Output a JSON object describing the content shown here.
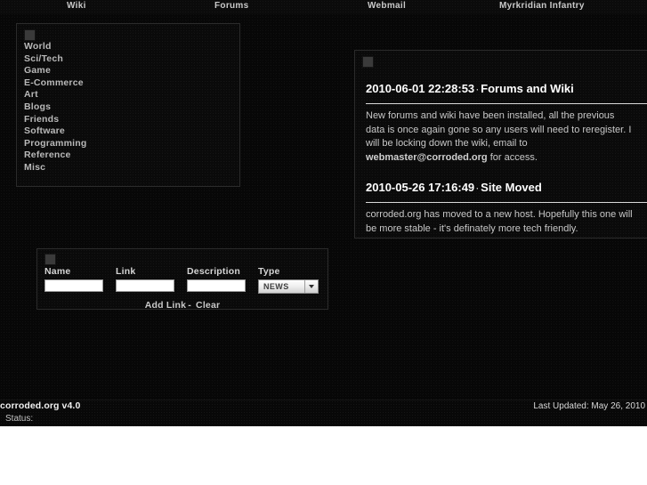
{
  "nav": {
    "items": [
      {
        "label": "Wiki",
        "name": "nav-link-wiki"
      },
      {
        "label": "Forums",
        "name": "nav-link-forums"
      },
      {
        "label": "Webmail",
        "name": "nav-link-webmail"
      },
      {
        "label": "Myrkridian Infantry",
        "name": "nav-link-myrkridian-infantry"
      }
    ]
  },
  "links_panel": {
    "placeholder_icon": "broken-image-icon",
    "categories": [
      {
        "label": "World"
      },
      {
        "label": "Sci/Tech"
      },
      {
        "label": "Game"
      },
      {
        "label": "E-Commerce"
      },
      {
        "label": "Art"
      },
      {
        "label": "Blogs"
      },
      {
        "label": "Friends"
      },
      {
        "label": "Software"
      },
      {
        "label": "Programming"
      },
      {
        "label": "Reference"
      },
      {
        "label": "Misc"
      }
    ]
  },
  "news_panel": {
    "placeholder_icon": "broken-image-icon",
    "separator": "·",
    "items": [
      {
        "date": "2010-06-01 22:28:53",
        "title": "Forums and Wiki",
        "body_before_link": "New forums and wiki have been installed, all the previous data is once again gone so any users will need to reregister. I will be locking down the wiki, email to ",
        "link": "webmaster@corroded.org",
        "body_after_link": " for access."
      },
      {
        "date": "2010-05-26 17:16:49",
        "title": "Site Moved",
        "body": "corroded.org has moved to a new host. Hopefully this one will be more stable - it's definately more tech friendly."
      }
    ]
  },
  "form_panel": {
    "placeholder_icon": "broken-image-icon",
    "fields": [
      {
        "label": "Name",
        "value": "",
        "placeholder": ""
      },
      {
        "label": "Link",
        "value": "",
        "placeholder": ""
      },
      {
        "label": "Description",
        "value": "",
        "placeholder": ""
      }
    ],
    "type_field": {
      "label": "Type",
      "selected": "NEWS",
      "options": [
        "NEWS"
      ],
      "arrow_icon": "chevron-down-icon"
    },
    "actions": {
      "add_label": "Add Link",
      "separator": "-",
      "clear_label": "Clear"
    }
  },
  "footer": {
    "brand": "corroded.org v4.0",
    "last_updated": "Last Updated: May 26, 2010",
    "status": "Status:"
  },
  "colors": {
    "page_background": "#070707",
    "panel_border": "#2b2b2b",
    "text_primary": "#ffffff",
    "text_secondary": "#c8c8c8",
    "link": "#b9b9b9",
    "input_background": "#ffffff"
  }
}
